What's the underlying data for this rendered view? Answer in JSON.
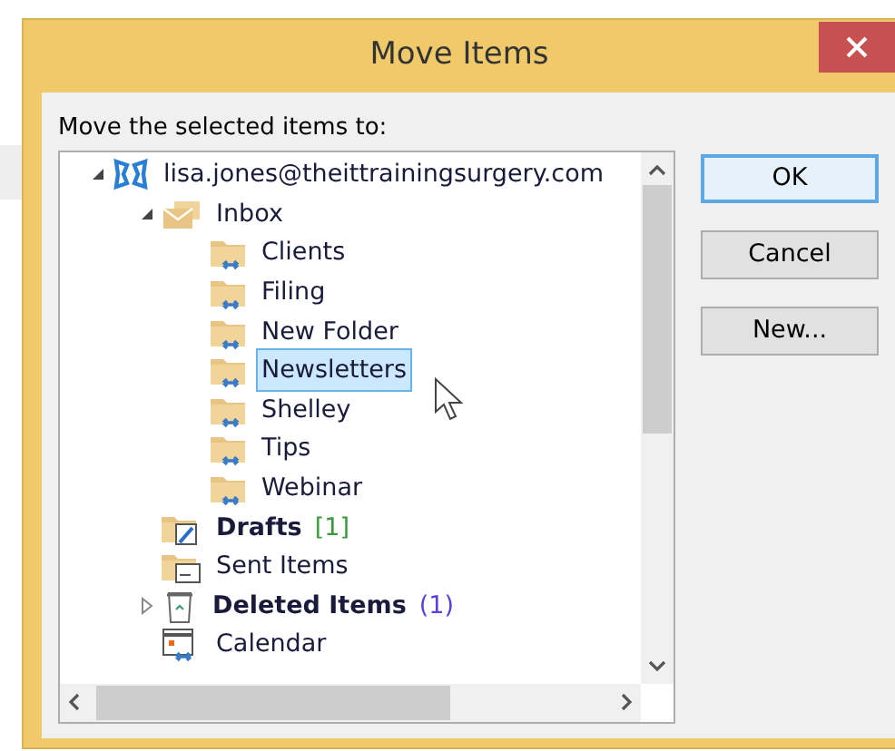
{
  "window": {
    "title": "Move Items"
  },
  "prompt": "Move the selected items to:",
  "tree": [
    {
      "label": "lisa.jones@theittrainingsurgery.com",
      "kind": "account",
      "expanded": true,
      "bold": false,
      "selected": false,
      "children": [
        {
          "label": "Inbox",
          "kind": "inbox",
          "expanded": true,
          "bold": false,
          "selected": false,
          "children": [
            {
              "label": "Clients",
              "kind": "folder",
              "bold": false,
              "selected": false
            },
            {
              "label": "Filing",
              "kind": "folder",
              "bold": false,
              "selected": false
            },
            {
              "label": "New Folder",
              "kind": "folder",
              "bold": false,
              "selected": false
            },
            {
              "label": "Newsletters",
              "kind": "folder",
              "bold": false,
              "selected": true
            },
            {
              "label": "Shelley",
              "kind": "folder",
              "bold": false,
              "selected": false
            },
            {
              "label": "Tips",
              "kind": "folder",
              "bold": false,
              "selected": false
            },
            {
              "label": "Webinar",
              "kind": "folder",
              "bold": false,
              "selected": false
            }
          ]
        },
        {
          "label": "Drafts",
          "kind": "drafts",
          "bold": true,
          "selected": false,
          "count": "[1]",
          "color": "#3a9a3a"
        },
        {
          "label": "Sent Items",
          "kind": "sent",
          "bold": false,
          "selected": false
        },
        {
          "label": "Deleted Items",
          "kind": "deleted",
          "expanded": false,
          "expandable": true,
          "bold": true,
          "selected": false,
          "count": "(1)",
          "color": "#5a3ee0"
        },
        {
          "label": "Calendar",
          "kind": "calendar",
          "bold": false,
          "selected": false
        }
      ]
    }
  ],
  "buttons": [
    {
      "label": "OK",
      "kind": "default"
    },
    {
      "label": "Cancel",
      "kind": "normal"
    },
    {
      "label": "New...",
      "kind": "normal"
    }
  ]
}
